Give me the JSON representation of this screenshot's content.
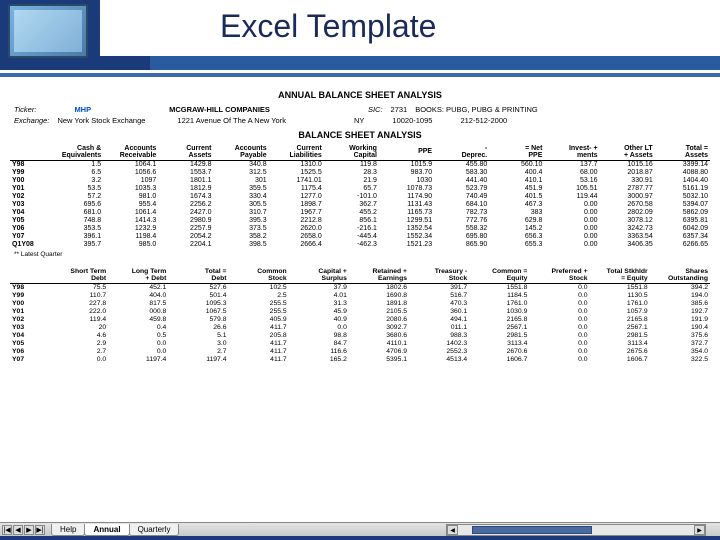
{
  "header": {
    "title": "Excel Template"
  },
  "sheet": {
    "title1": "ANNUAL BALANCE SHEET ANALYSIS",
    "company": {
      "ticker_lbl": "Ticker:",
      "ticker": "MHP",
      "name": "MCGRAW-HILL COMPANIES",
      "sic_lbl": "SIC:",
      "sic": "2731",
      "sic_desc": "BOOKS: PUBG, PUBG & PRINTING",
      "exch_lbl": "Exchange:",
      "exch": "New York Stock Exchange",
      "addr": "1221 Avenue Of The A New York",
      "state": "NY",
      "zip": "10020-1095",
      "phone": "212-512-2000"
    },
    "title2": "BALANCE SHEET ANALYSIS",
    "table1": {
      "headers": [
        "",
        "Cash & Equivalents",
        "Accounts Receivable",
        "Current Assets",
        "Accounts Payable",
        "Current Liabilities",
        "Working Capital",
        "PPE",
        "- Deprec.",
        "= Net PPE",
        "Invest- + ments",
        "Other LT + Assets",
        "Total = Assets"
      ],
      "rows": [
        [
          "Y98",
          "1.5",
          "1064.1",
          "1429.8",
          "340.8",
          "1310.0",
          "119.8",
          "1015.9",
          "455.80",
          "560.10",
          "137.7",
          "1015.16",
          "3399.14"
        ],
        [
          "Y99",
          "6.5",
          "1056.6",
          "1553.7",
          "312.5",
          "1525.5",
          "28.3",
          "983.70",
          "583.30",
          "400.4",
          "68.00",
          "2018.87",
          "4088.80"
        ],
        [
          "Y00",
          "3.2",
          "1097",
          "1801.1",
          "301",
          "1741.01",
          "21.9",
          "1030",
          "441.40",
          "410.1",
          "53.16",
          "330.91",
          "1404.40"
        ],
        [
          "Y01",
          "53.5",
          "1035.3",
          "1812.9",
          "359.5",
          "1175.4",
          "65.7",
          "1078.73",
          "523.79",
          "451.9",
          "105.51",
          "2787.77",
          "5161.19"
        ],
        [
          "Y02",
          "57.2",
          "981.0",
          "1674.3",
          "330.4",
          "1277.0",
          "-101.0",
          "1174.90",
          "740.49",
          "401.5",
          "119.44",
          "3000.97",
          "5032.10"
        ],
        [
          "Y03",
          "695.6",
          "955.4",
          "2256.2",
          "305.5",
          "1898.7",
          "362.7",
          "1131.43",
          "684.10",
          "467.3",
          "0.00",
          "2670.58",
          "5394.07"
        ],
        [
          "Y04",
          "681.0",
          "1061.4",
          "2427.0",
          "310.7",
          "1967.7",
          "455.2",
          "1165.73",
          "782.73",
          "383",
          "0.00",
          "2802.09",
          "5862.09"
        ],
        [
          "Y05",
          "748.8",
          "1414.3",
          "2980.9",
          "395.3",
          "2212.8",
          "856.1",
          "1299.51",
          "772.76",
          "629.8",
          "0.00",
          "3078.12",
          "6395.81"
        ],
        [
          "Y06",
          "353.5",
          "1232.9",
          "2257.9",
          "373.5",
          "2620.0",
          "-216.1",
          "1352.54",
          "558.32",
          "145.2",
          "0.00",
          "3242.73",
          "6042.09"
        ],
        [
          "Y07",
          "396.1",
          "1198.4",
          "2054.2",
          "358.2",
          "2658.0",
          "-445.4",
          "1552.34",
          "695.80",
          "656.3",
          "0.00",
          "3363.54",
          "6357.34"
        ],
        [
          "Q1Y08",
          "395.7",
          "985.0",
          "2204.1",
          "398.5",
          "2666.4",
          "-462.3",
          "1521.23",
          "865.90",
          "655.3",
          "0.00",
          "3406.35",
          "6266.65"
        ]
      ]
    },
    "note": "** Latest Quarter",
    "table2": {
      "headers": [
        "",
        "Short Term Debt",
        "Long Term + Debt",
        "Total = Debt",
        "Common Stock",
        "Capital + Surplus",
        "Retained + Earnings",
        "Treasury - Stock",
        "Common = Equity",
        "Preferred + Stock",
        "Total Stkhldr = Equity",
        "Shares Outstanding"
      ],
      "rows": [
        [
          "Y98",
          "75.5",
          "452.1",
          "527.6",
          "102.5",
          "37.9",
          "1802.6",
          "391.7",
          "1551.8",
          "0.0",
          "1551.8",
          "394.2"
        ],
        [
          "Y99",
          "110.7",
          "404.0",
          "501.4",
          "2.5",
          "4.01",
          "1690.8",
          "516.7",
          "1184.5",
          "0.0",
          "1130.5",
          "194.0"
        ],
        [
          "Y00",
          "227.8",
          "817.5",
          "1095.3",
          "255.5",
          "31.3",
          "1891.8",
          "470.3",
          "1761.0",
          "0.0",
          "1761.0",
          "385.6"
        ],
        [
          "Y01",
          "222.0",
          "000.8",
          "1067.5",
          "255.5",
          "45.9",
          "2105.5",
          "360.1",
          "1030.9",
          "0.0",
          "1057.9",
          "192.7"
        ],
        [
          "Y02",
          "119.4",
          "459.8",
          "579.8",
          "405.9",
          "40.9",
          "2080.6",
          "494.1",
          "2165.8",
          "0.0",
          "2165.8",
          "191.9"
        ],
        [
          "Y03",
          "20",
          "0.4",
          "26.6",
          "411.7",
          "0.0",
          "3092.7",
          "011.1",
          "2567.1",
          "0.0",
          "2567.1",
          "190.4"
        ],
        [
          "Y04",
          "4.6",
          "0.5",
          "5.1",
          "205.8",
          "98.8",
          "3680.6",
          "988.3",
          "2981.5",
          "0.0",
          "2981.5",
          "375.6"
        ],
        [
          "Y05",
          "2.9",
          "0.0",
          "3.0",
          "411.7",
          "84.7",
          "4110.1",
          "1402.3",
          "3113.4",
          "0.0",
          "3113.4",
          "372.7"
        ],
        [
          "Y06",
          "2.7",
          "0.0",
          "2.7",
          "411.7",
          "116.6",
          "4706.9",
          "2552.3",
          "2670.6",
          "0.0",
          "2675.6",
          "354.0"
        ],
        [
          "Y07",
          "0.0",
          "1197.4",
          "1197.4",
          "411.7",
          "165.2",
          "5395.1",
          "4513.4",
          "1606.7",
          "0.0",
          "1606.7",
          "322.5"
        ]
      ]
    }
  },
  "tabs": {
    "nav": [
      "|◀",
      "◀",
      "▶",
      "▶|"
    ],
    "items": [
      "Help",
      "Annual",
      "Quarterly"
    ],
    "active": 1
  }
}
